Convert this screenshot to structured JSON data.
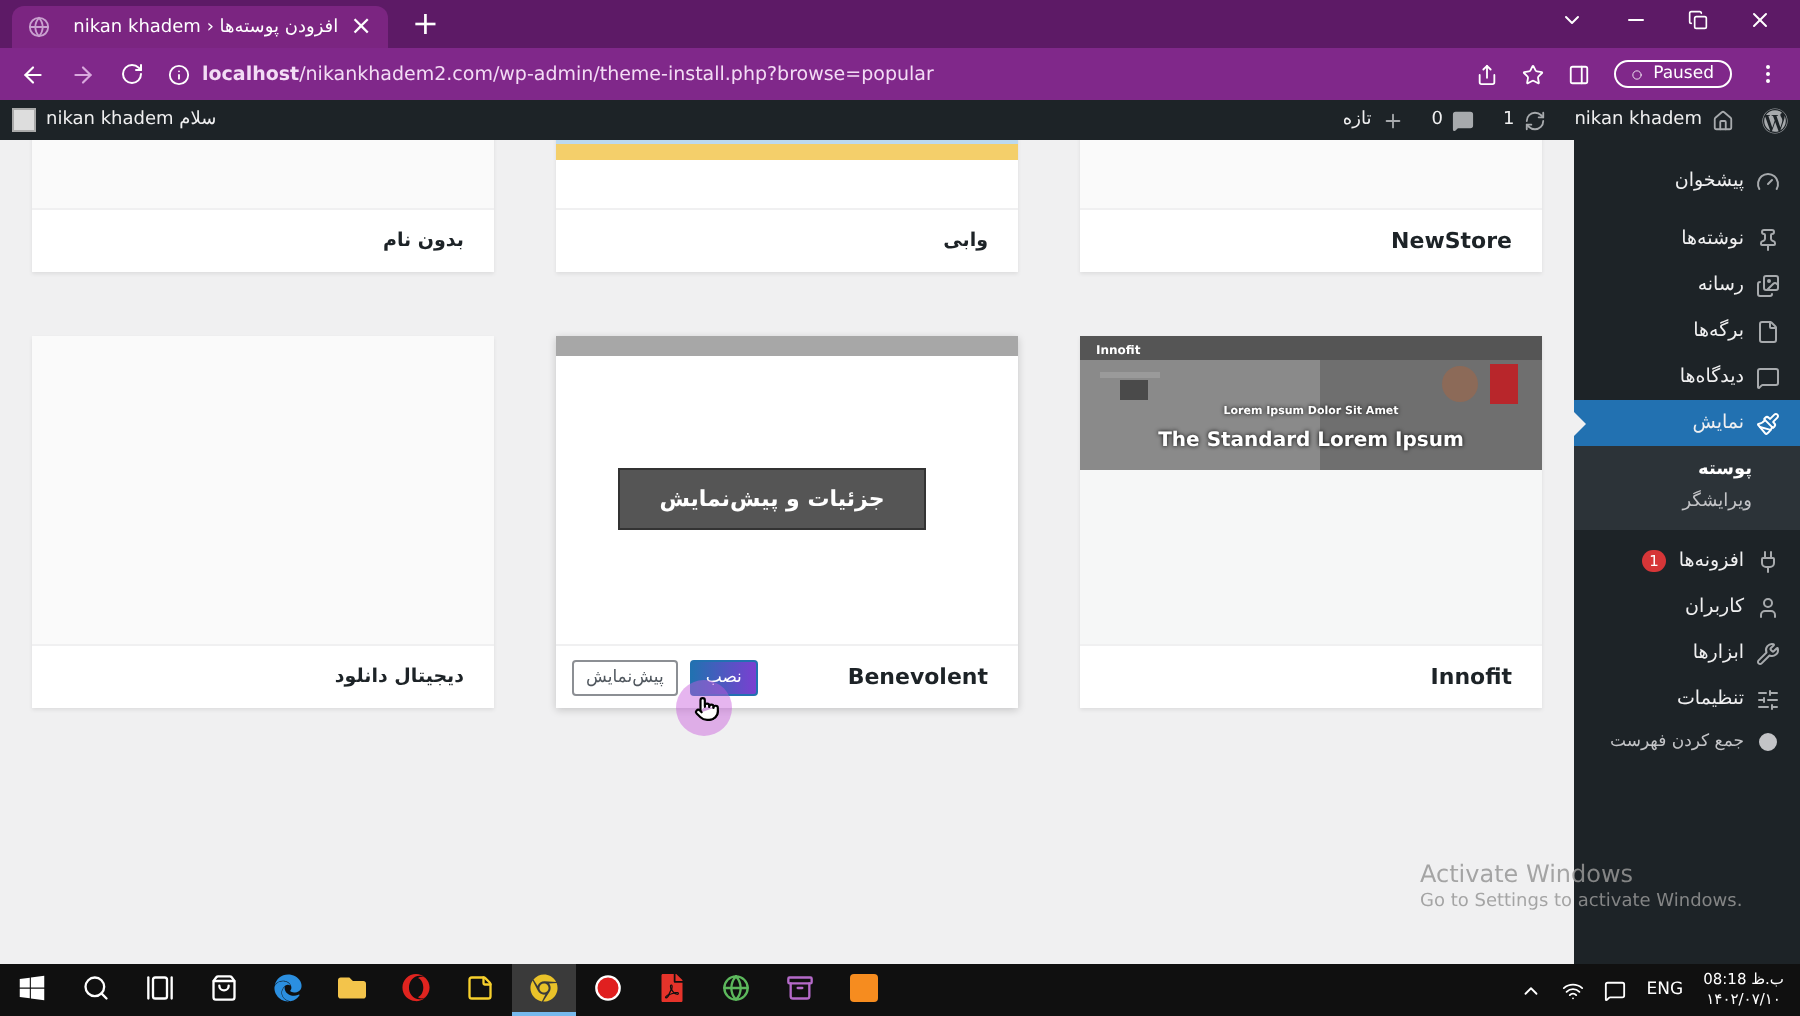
{
  "browser": {
    "tab": {
      "title": "افزودن پوسته‌ها ‹ nikan khadem",
      "close": "×"
    },
    "new_tab": "+",
    "address": "**localhost**/nikankhadem2.com/wp-admin/theme-install.php?browse=popular",
    "profile_button": "Paused"
  },
  "admin_bar": {
    "site_name": "nikan khadem",
    "updates": "1",
    "comments": "0",
    "new": "تازه",
    "greeting": "سلام nikan khadem"
  },
  "themes": [
    {
      "name": "NewStore",
      "kind": "blank",
      "hovered": false
    },
    {
      "name": "وابی",
      "kind": "picture",
      "hovered": false
    },
    {
      "name": "بدون نام",
      "kind": "blank",
      "hovered": false
    },
    {
      "name": "Innofit",
      "kind": "screenshot",
      "hovered": false,
      "screenshot": {
        "logo": "Innofit",
        "tagline": "Lorem Ipsum Dolor Sit Amet",
        "heading": "The Standard Lorem Ipsum"
      }
    },
    {
      "name": "Benevolent",
      "kind": "strip",
      "hovered": true,
      "details_button": "جزئیات و پیش‌نمایش",
      "install_button": "نصب",
      "preview_button": "پیش‌نمایش"
    },
    {
      "name": "دیجیتال دانلود",
      "kind": "blank",
      "hovered": false
    }
  ],
  "menu": [
    {
      "label": "پیشخوان",
      "kind": "dashboard",
      "selected": false
    },
    {
      "label": "نوشته‌ها",
      "kind": "pin",
      "selected": false
    },
    {
      "label": "رسانه",
      "kind": "media",
      "selected": false
    },
    {
      "label": "برگه‌ها",
      "kind": "page",
      "selected": false
    },
    {
      "label": "دیدگاه‌ها",
      "kind": "comment",
      "selected": false
    },
    {
      "label": "نمایش",
      "kind": "brush",
      "selected": true,
      "children": [
        {
          "label": "پوسته",
          "selected": true
        },
        {
          "label": "ویرایشگر",
          "selected": false
        }
      ]
    },
    {
      "label": "افزونه‌ها",
      "kind": "plug",
      "selected": false,
      "badge": "1"
    },
    {
      "label": "کاربران",
      "kind": "user",
      "selected": false
    },
    {
      "label": "ابزارها",
      "kind": "wrench",
      "selected": false
    },
    {
      "label": "تنظیمات",
      "kind": "settings",
      "selected": false
    }
  ],
  "collapse_menu": "جمع کردن فهرست",
  "activation": {
    "title": "Activate Windows",
    "hint": "Go to Settings to activate Windows."
  },
  "taskbar": {
    "apps": [
      {
        "kind": "start",
        "active": false
      },
      {
        "kind": "search",
        "active": false
      },
      {
        "kind": "taskview",
        "active": false
      },
      {
        "kind": "store",
        "active": false
      },
      {
        "kind": "edge",
        "active": false
      },
      {
        "kind": "explorer",
        "active": false
      },
      {
        "kind": "opera",
        "active": false
      },
      {
        "kind": "notes",
        "active": false
      },
      {
        "kind": "chrome",
        "active": true
      },
      {
        "kind": "recorder",
        "active": false
      },
      {
        "kind": "acrobat",
        "active": false
      },
      {
        "kind": "downloader",
        "active": false
      },
      {
        "kind": "archiver",
        "active": false
      },
      {
        "kind": "xampp",
        "active": false
      }
    ],
    "language": "ENG",
    "time": "08:18 ب.ظ",
    "date": "۱۴۰۲/۰۷/۱۰"
  }
}
